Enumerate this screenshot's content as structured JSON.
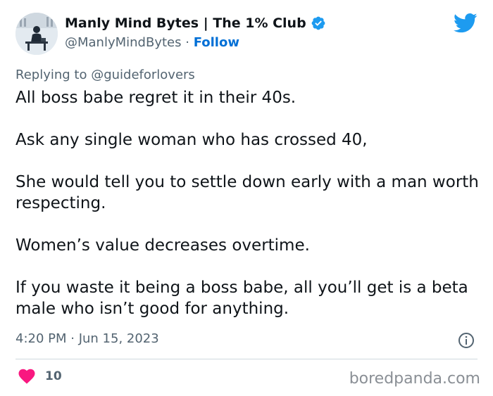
{
  "author": {
    "display_name": "Manly Mind Bytes | The 1% Club",
    "handle": "@ManlyMindBytes",
    "separator": "·",
    "follow_label": "Follow",
    "avatar_icon": "person-at-desk-avatar",
    "verified_icon": "verified-badge-icon"
  },
  "reply": {
    "prefix": "Replying to ",
    "target": "@guideforlovers"
  },
  "tweet": {
    "paragraphs": [
      "All boss babe regret it in their 40s.",
      "Ask any single woman who has crossed 40,",
      "She would tell you to settle down early with a man worth respecting.",
      "Women’s value decreases overtime.",
      "If you waste it being a boss babe, all you’ll get is a beta male who isn’t good for anything."
    ],
    "timestamp": "4:20 PM · Jun 15, 2023",
    "like_count": "10"
  },
  "watermark": "boredpanda.com",
  "colors": {
    "twitter_blue": "#1d9bf0",
    "link_blue": "#006fd6",
    "heart_red": "#f91880",
    "muted_text": "#536471"
  }
}
